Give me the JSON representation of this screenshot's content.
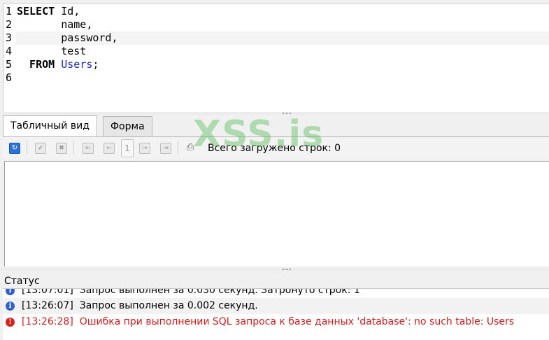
{
  "editor": {
    "line_numbers": [
      "1",
      "2",
      "3",
      "4",
      "5",
      "6"
    ],
    "lines": [
      {
        "kw": "SELECT",
        "rest": " Id,"
      },
      {
        "kw": "",
        "rest": "       name,"
      },
      {
        "kw": "",
        "rest": "       password,"
      },
      {
        "kw": "",
        "rest": "       test"
      },
      {
        "kw": "  FROM",
        "table": " Users",
        "end": ";"
      },
      {
        "kw": "",
        "rest": ""
      }
    ]
  },
  "tabs": [
    {
      "label": "Табличный вид"
    },
    {
      "label": "Форма"
    }
  ],
  "toolbar": {
    "refresh_icon": "refresh-icon",
    "page_number": "1",
    "loaded_text": "Всего загружено строк: 0"
  },
  "status": {
    "title": "Статус",
    "entries": [
      {
        "type": "info",
        "time": "[13:07:01]",
        "message": "Запрос выполнен за 0.030 секунд. Затронуто строк: 1"
      },
      {
        "type": "info",
        "time": "[13:26:07]",
        "message": "Запрос выполнен за 0.002 секунд."
      },
      {
        "type": "error",
        "time": "[13:26:28]",
        "message": "Ошибка при выполнении SQL запроса к базе данных 'database': no such table: Users"
      }
    ]
  },
  "watermark": "XSS.is",
  "colors": {
    "keyword_table": "#1a27c9",
    "error": "#d21c1c",
    "info": "#2f5fc8",
    "watermark": "#60be60"
  }
}
